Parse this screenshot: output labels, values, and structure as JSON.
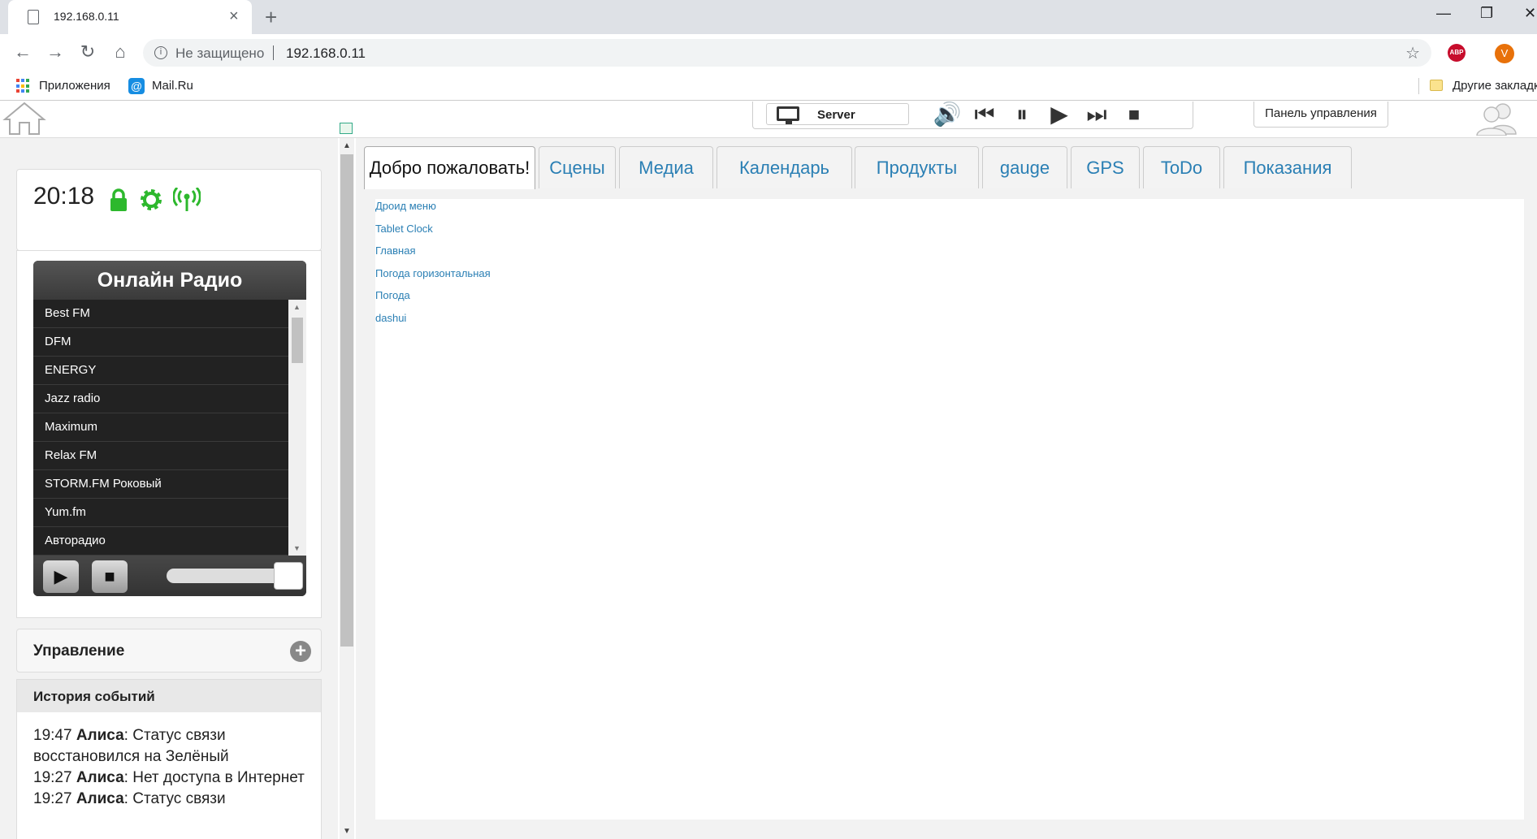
{
  "browser": {
    "tab_title": "192.168.0.11",
    "new_tab": "+",
    "window_controls": {
      "minimize": "—",
      "restore": "❐",
      "close": "✕"
    },
    "nav": {
      "back": "←",
      "forward": "→",
      "reload": "↻",
      "home": "⌂"
    },
    "security_text": "Не защищено",
    "url": "192.168.0.11",
    "bookmark_star": "☆",
    "abp_label": "ABP",
    "profile_initial": "V",
    "bookmarks": {
      "apps": "Приложения",
      "mail": "Mail.Ru",
      "mail_icon": "@",
      "other": "Другие закладк"
    }
  },
  "topbar": {
    "server_label": "Server",
    "media_controls": {
      "volume": "🔊",
      "prev": "⏮",
      "pause": "⏸",
      "play": "▶",
      "next": "⏭",
      "stop": "⏹"
    },
    "control_panel_label": "Панель управления"
  },
  "sidebar": {
    "time": "20:18",
    "radio": {
      "title": "Онлайн Радио",
      "stations": [
        "Best FM",
        "DFM",
        "ENERGY",
        "Jazz radio",
        "Maximum",
        "Relax FM",
        "STORM.FM Роковый",
        "Yum.fm",
        "Авторадио"
      ],
      "play": "▶",
      "stop": "■",
      "volume_level": 1.0
    },
    "control": {
      "label": "Управление",
      "plus": "+"
    },
    "history": {
      "label": "История событий",
      "events": [
        {
          "time": "19:47",
          "who": "Алиса",
          "text": ": Статус связи восстановился на Зелёный"
        },
        {
          "time": "19:27",
          "who": "Алиса",
          "text": ": Нет доступа в Интернет"
        },
        {
          "time": "19:27",
          "who": "Алиса",
          "text": ": Статус связи"
        }
      ]
    }
  },
  "main": {
    "tabs": [
      "Добро пожаловать!",
      "Сцены",
      "Медиа",
      "Календарь",
      "Продукты",
      "gauge",
      "GPS",
      "ToDo",
      "Показания"
    ],
    "links": [
      "Дроид меню",
      "Tablet Clock",
      "Главная",
      "Погода горизонтальная",
      "Погода",
      "dashui"
    ]
  },
  "colors": {
    "link": "#2a7fb4",
    "status_green": "#2db82d",
    "radio_bg": "#2a2a2a"
  }
}
